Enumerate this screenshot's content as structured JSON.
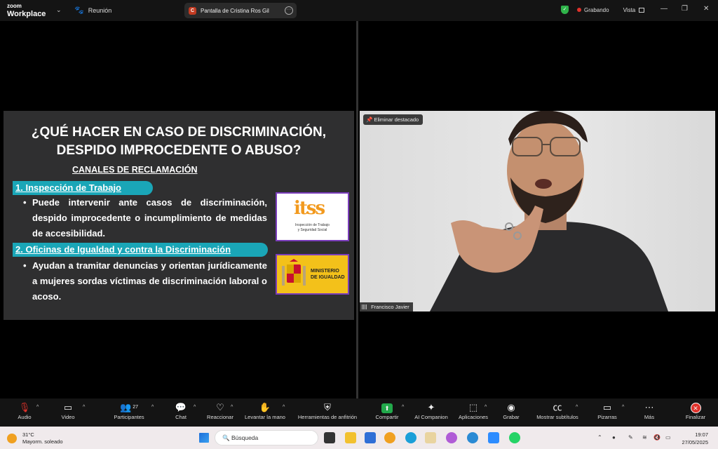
{
  "titlebar": {
    "brand_top": "zoom",
    "brand_bottom": "Workplace",
    "meeting_label": "Reunión",
    "share_label": "Pantalla de Cristina Ros Gil",
    "share_badge": "C",
    "recording_label": "Grabando",
    "view_label": "Vista"
  },
  "slide": {
    "title_line1": "¿QUÉ HACER EN CASO DE DISCRIMINACIÓN,",
    "title_line2": "DESPIDO IMPROCEDENTE O ABUSO?",
    "section": "CANALES DE RECLAMACIÓN",
    "item1_header": "1. Inspección de Trabajo",
    "item1_body": "Puede intervenir ante casos de discriminación, despido improcedente o incumplimiento de medidas de accesibilidad.",
    "item2_header": "2. Oficinas de Igualdad y contra la Discriminación",
    "item2_body": "Ayudan a tramitar denuncias y orientan jurídicamente a mujeres sordas víctimas de discriminación laboral o acoso.",
    "logo1_mark": "itss",
    "logo1_caption_l1": "Inspección de Trabajo",
    "logo1_caption_l2": "y Seguridad Social",
    "logo2_l1": "MINISTERIO",
    "logo2_l2": "DE IGUALDAD"
  },
  "video": {
    "spotlight_chip": "Eliminar destacado",
    "participant_name": "Francisco Javier"
  },
  "toolbar": {
    "audio": "Audio",
    "video": "Video",
    "participants": "Participantes",
    "participants_count": "27",
    "chat": "Chat",
    "react": "Reaccionar",
    "raise_hand": "Levantar la mano",
    "host_tools": "Herramientas de anfitrión",
    "share": "Compartir",
    "ai": "AI Companion",
    "apps": "Aplicaciones",
    "record": "Grabar",
    "captions": "Mostrar subtítulos",
    "whiteboards": "Pizarras",
    "more": "Más",
    "end": "Finalizar"
  },
  "taskbar": {
    "temp": "31°C",
    "weather": "Mayorm. soleado",
    "search": "Búsqueda",
    "time": "19:07",
    "date": "27/05/2025"
  },
  "colors": {
    "accent_teal": "#1aa6b7",
    "record_red": "#e0322b",
    "share_green": "#22a94b"
  }
}
